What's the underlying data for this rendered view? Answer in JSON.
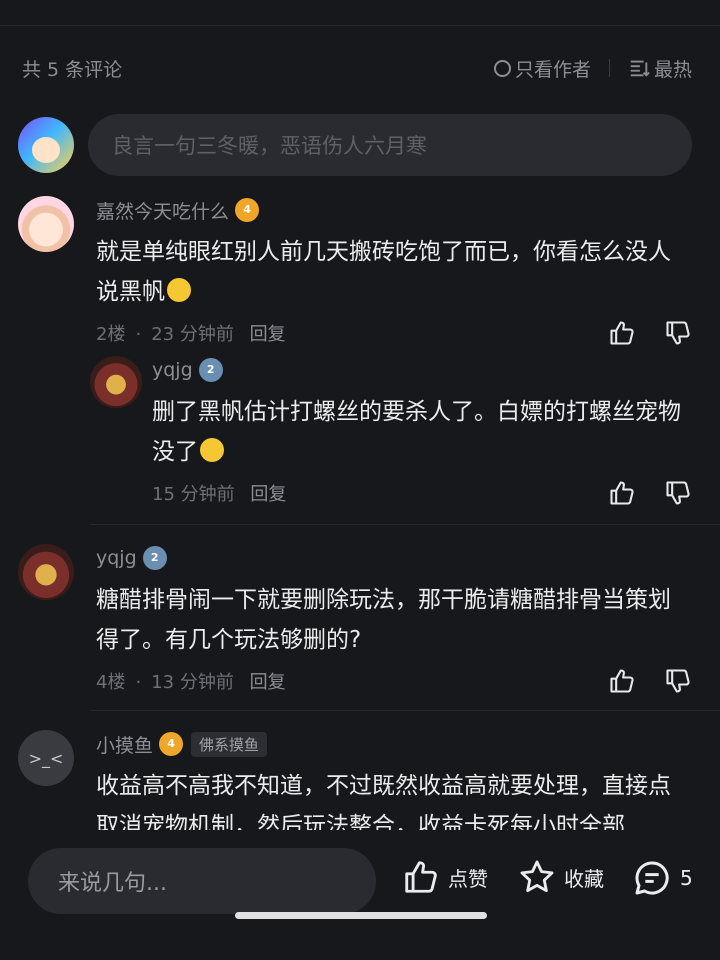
{
  "header": {
    "count_label": "共 5 条评论",
    "author_only_label": "只看作者",
    "sort_label": "最热"
  },
  "compose": {
    "placeholder": "良言一句三冬暖，恶语伤人六月寒"
  },
  "comments": [
    {
      "username": "嘉然今天吃什么",
      "level": "4",
      "text": "就是单纯眼红别人前几天搬砖吃饱了而已，你看怎么没人说黑帆",
      "floor": "2楼",
      "time": "23 分钟前",
      "reply_label": "回复",
      "replies": [
        {
          "username": "yqjg",
          "level": "2",
          "text": "删了黑帆估计打螺丝的要杀人了。白嫖的打螺丝宠物没了",
          "time": "15 分钟前",
          "reply_label": "回复"
        }
      ]
    },
    {
      "username": "yqjg",
      "level": "2",
      "text": "糖醋排骨闹一下就要删除玩法，那干脆请糖醋排骨当策划得了。有几个玩法够删的?",
      "floor": "4楼",
      "time": "13 分钟前",
      "reply_label": "回复"
    },
    {
      "username": "小摸鱼",
      "level": "4",
      "tag": "佛系摸鱼",
      "text": "收益高不高我不知道，不过既然收益高就要处理，直接点取消宠物机制，然后玩法整合，收益卡死每小时全部"
    }
  ],
  "bottom": {
    "input_placeholder": "来说几句...",
    "like_label": "点赞",
    "fav_label": "收藏",
    "comment_count": "5"
  },
  "colors": {
    "background": "#17181c",
    "input_bg": "#2a2b30",
    "muted_text": "#8d8e93",
    "level_gold": "#f0a629",
    "level_blue": "#6a8fb3"
  }
}
